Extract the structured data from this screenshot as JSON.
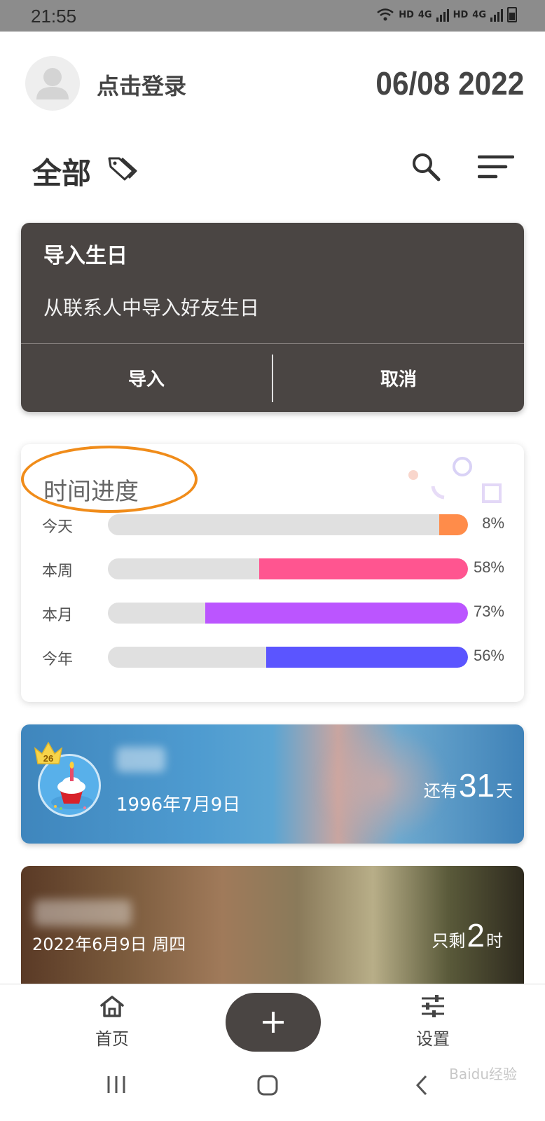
{
  "status_bar": {
    "time": "21:55",
    "net1": "HD",
    "net2": "4G",
    "net3": "HD",
    "net4": "4G"
  },
  "header": {
    "login_text": "点击登录",
    "date": "06/08 2022"
  },
  "section": {
    "title": "全部"
  },
  "import_card": {
    "title": "导入生日",
    "description": "从联系人中导入好友生日",
    "import_label": "导入",
    "cancel_label": "取消"
  },
  "progress_card": {
    "title": "时间进度",
    "rows": [
      {
        "label": "今天",
        "percent_text": "8%",
        "value": 8,
        "color": "#ff8c4a"
      },
      {
        "label": "本周",
        "percent_text": "58%",
        "value": 58,
        "color": "#ff5590"
      },
      {
        "label": "本月",
        "percent_text": "73%",
        "value": 73,
        "color": "#bb55ff"
      },
      {
        "label": "今年",
        "percent_text": "56%",
        "value": 56,
        "color": "#5b55ff"
      }
    ]
  },
  "birthday_card": {
    "age_badge": "26",
    "date": "1996年7月9日",
    "remain_prefix": "还有",
    "remain_value": "31",
    "remain_unit": "天"
  },
  "event_card": {
    "date": "2022年6月9日 周四",
    "remain_prefix": "只剩",
    "remain_value": "2",
    "remain_unit": "时"
  },
  "bottom_nav": {
    "home_label": "首页",
    "settings_label": "设置"
  },
  "watermark": "Baidu经验"
}
